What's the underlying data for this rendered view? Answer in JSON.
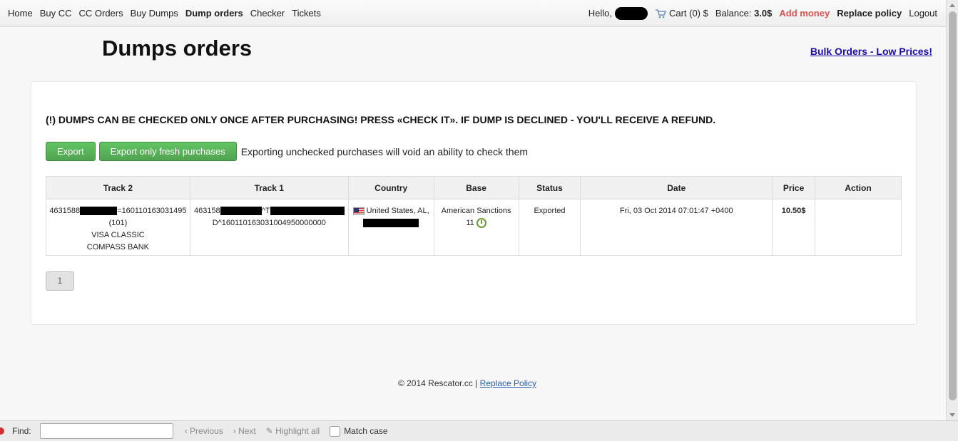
{
  "nav": {
    "left": [
      "Home",
      "Buy CC",
      "CC Orders",
      "Buy Dumps",
      "Dump orders",
      "Checker",
      "Tickets"
    ],
    "hello": "Hello,",
    "cart": "Cart (0) $",
    "balance_label": "Balance:",
    "balance_value": "3.0$",
    "add_money": "Add money",
    "replace_policy": "Replace policy",
    "logout": "Logout"
  },
  "page": {
    "title": "Dumps orders",
    "bulk_link": "Bulk Orders - Low Prices!",
    "notice": "(!) DUMPS CAN BE CHECKED ONLY ONCE AFTER PURCHASING! PRESS «CHECK IT». IF DUMP IS DECLINED - YOU'LL RECEIVE A REFUND.",
    "export_btn": "Export",
    "export_fresh_btn": "Export only fresh purchases",
    "export_note": "Exporting unchecked purchases will void an ability to check them"
  },
  "table": {
    "headers": [
      "Track 2",
      "Track 1",
      "Country",
      "Base",
      "Status",
      "Date",
      "Price",
      "Action"
    ],
    "row": {
      "track2_prefix": "4631588",
      "track2_suffix": "=160110163031495",
      "track2_code": "(101)",
      "track2_type": "VISA CLASSIC",
      "track2_bank": "COMPASS BANK",
      "track1_prefix": "463158",
      "track1_mid": "^T",
      "track1_line2": "D^160110163031004950000000",
      "country": "United States, AL,",
      "base_line1": "American Sanctions",
      "base_line2": "11",
      "status": "Exported",
      "date": "Fri, 03 Oct 2014 07:01:47 +0400",
      "price": "10.50$",
      "action": ""
    }
  },
  "pager": {
    "current": "1"
  },
  "footer": {
    "copyright": "© 2014 Rescator.cc |",
    "link": "Replace Policy"
  },
  "findbar": {
    "label": "Find:",
    "previous": "Previous",
    "next": "Next",
    "highlight": "Highlight all",
    "match_case": "Match case"
  }
}
